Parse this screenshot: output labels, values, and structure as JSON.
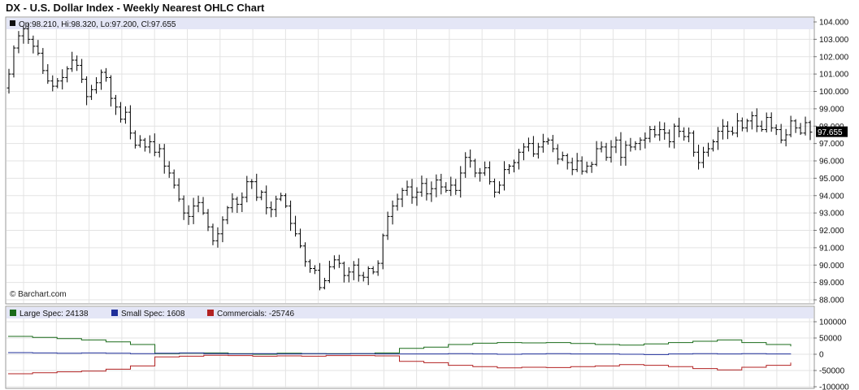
{
  "title": "DX - U.S. Dollar Index - Weekly Nearest OHLC Chart",
  "ohlc_info": "Op:98.210, Hi:98.320, Lo:97.200, Cl:97.655",
  "watermark": "© Barchart.com",
  "last_price_label": "97.655",
  "colors": {
    "grid": "#e3e3e3",
    "bar": "#000000",
    "large_spec": "#1a6b1a",
    "small_spec": "#1f2f9a",
    "commercials": "#b22222",
    "info_band": "#e4e6f6",
    "last_price_bg": "#000000"
  },
  "chart_data": [
    {
      "type": "ohlc",
      "title": "DX - U.S. Dollar Index - Weekly Nearest OHLC Chart",
      "ylim": [
        88,
        104
      ],
      "y_ticks": [
        "104.000",
        "103.000",
        "102.000",
        "101.000",
        "100.000",
        "99.000",
        "98.000",
        "97.000",
        "96.000",
        "95.000",
        "94.000",
        "93.000",
        "92.000",
        "91.000",
        "90.000",
        "89.000",
        "88.000"
      ],
      "last": {
        "open": 98.21,
        "high": 98.32,
        "low": 97.2,
        "close": 97.655
      },
      "closes": [
        101.0,
        102.5,
        103.2,
        103.6,
        103.0,
        102.6,
        102.2,
        101.2,
        100.6,
        100.3,
        100.6,
        100.8,
        101.3,
        101.8,
        101.5,
        100.7,
        99.7,
        100.1,
        100.5,
        101.1,
        100.8,
        99.6,
        99.1,
        98.4,
        98.8,
        97.6,
        96.9,
        97.2,
        96.8,
        97.1,
        96.5,
        96.7,
        95.7,
        95.3,
        94.6,
        93.8,
        93.0,
        92.8,
        93.4,
        93.6,
        93.0,
        92.2,
        91.4,
        91.8,
        92.6,
        93.3,
        93.8,
        93.5,
        93.9,
        94.8,
        94.8,
        93.9,
        94.2,
        93.3,
        93.2,
        93.8,
        94.0,
        93.4,
        92.4,
        91.8,
        91.1,
        90.2,
        89.8,
        89.7,
        88.7,
        89.1,
        89.9,
        90.3,
        90.1,
        89.4,
        89.6,
        90.0,
        89.4,
        89.3,
        89.8,
        89.6,
        90.1,
        91.7,
        92.8,
        93.4,
        93.8,
        94.3,
        94.5,
        93.9,
        94.2,
        94.7,
        94.1,
        94.4,
        94.9,
        94.5,
        94.3,
        94.6,
        94.3,
        95.3,
        96.2,
        96.0,
        95.3,
        95.3,
        95.6,
        94.8,
        94.2,
        94.6,
        95.5,
        95.7,
        95.9,
        96.5,
        96.8,
        97.0,
        96.4,
        96.8,
        97.1,
        97.2,
        96.7,
        96.1,
        96.3,
        95.9,
        95.5,
        96.0,
        95.4,
        95.7,
        95.8,
        96.7,
        96.8,
        96.2,
        96.8,
        97.2,
        96.2,
        96.9,
        96.8,
        97.0,
        97.2,
        97.3,
        97.8,
        97.5,
        97.8,
        97.6,
        97.1,
        98.0,
        97.7,
        97.4,
        97.6,
        96.5,
        95.9,
        96.5,
        96.7,
        97.1,
        97.7,
        98.0,
        97.7,
        97.6,
        98.3,
        97.9,
        98.3,
        98.6,
        98.0,
        97.8,
        98.5,
        97.9,
        97.8,
        97.2,
        97.5,
        98.3,
        97.9,
        97.6,
        98.2,
        97.655
      ]
    },
    {
      "type": "line",
      "ylim": [
        -100000,
        100000
      ],
      "y_ticks": [
        "100000",
        "50000",
        "0",
        "-50000",
        "-100000"
      ],
      "series": [
        {
          "name": "Large Spec: 24138",
          "start": 55000,
          "end": 24138
        },
        {
          "name": "Small Spec: 1608",
          "start": 5000,
          "end": 1608
        },
        {
          "name": "Commercials: -25746",
          "start": -60000,
          "end": -25746
        }
      ]
    }
  ]
}
